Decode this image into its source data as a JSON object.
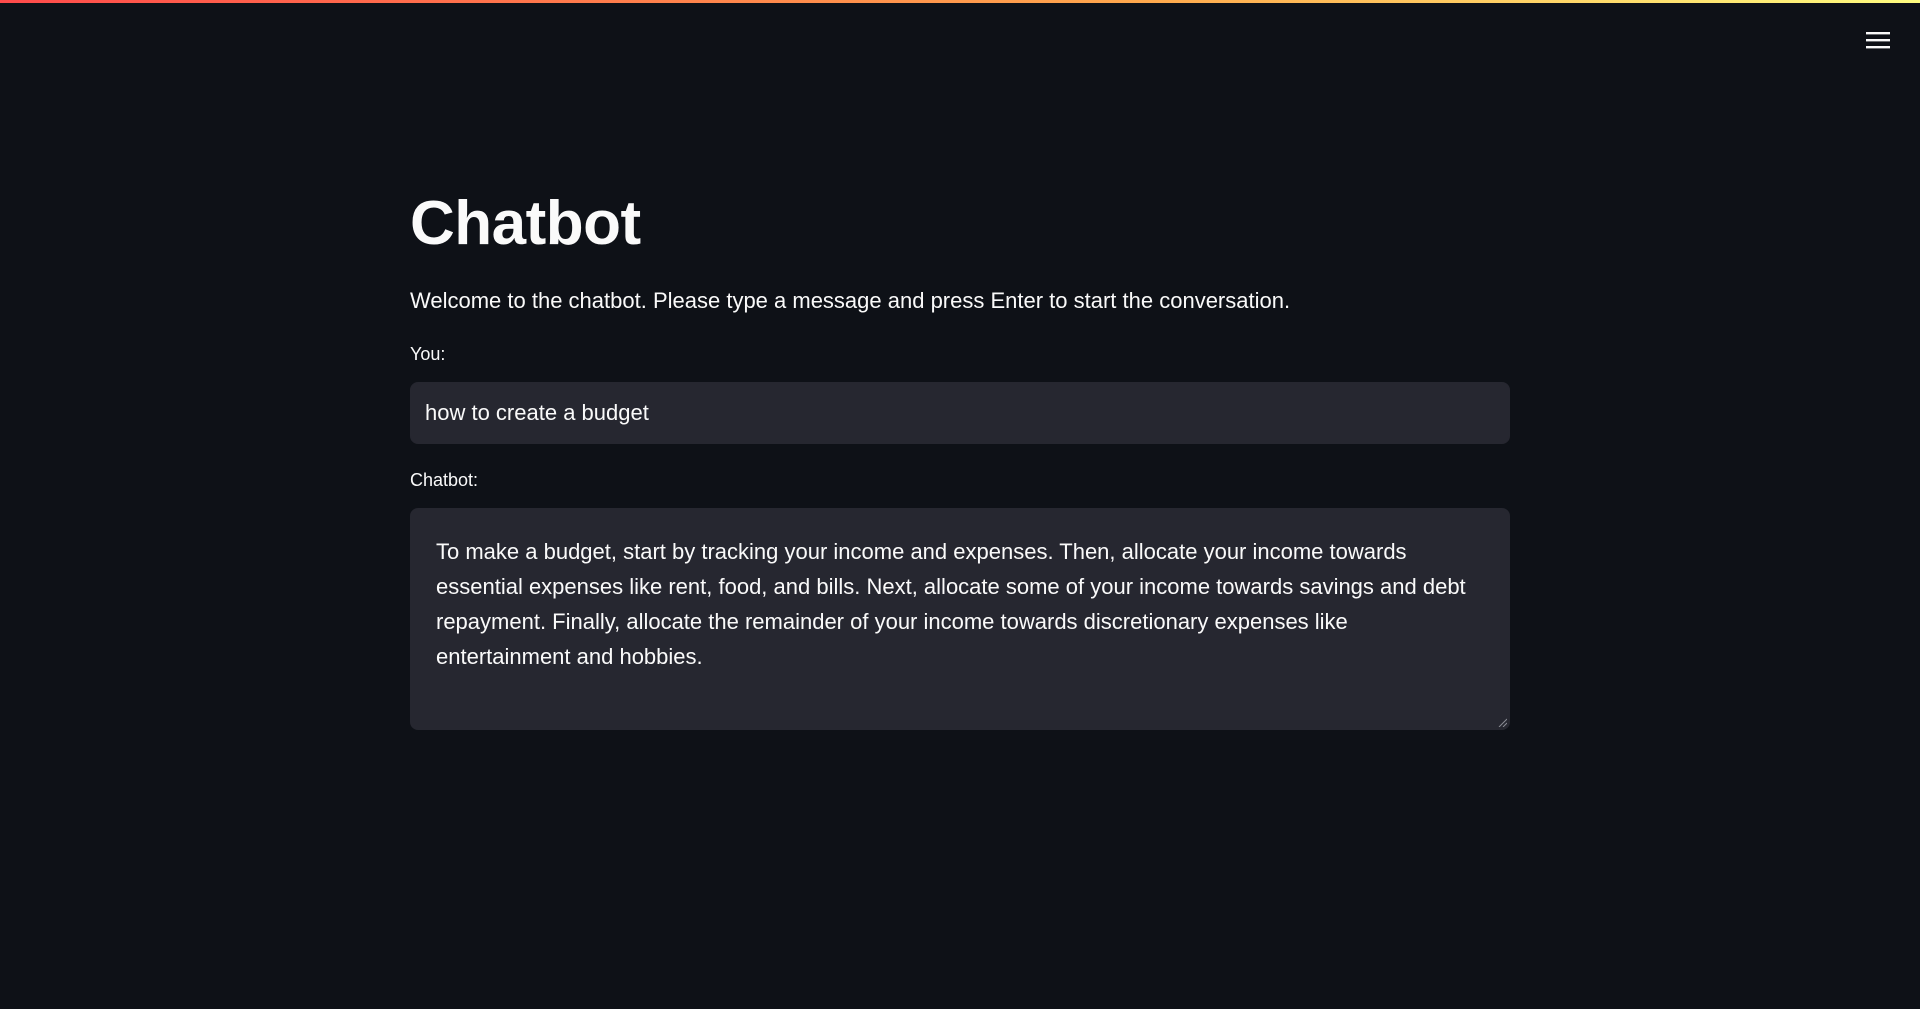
{
  "app": {
    "title": "Chatbot",
    "intro": "Welcome to the chatbot. Please type a message and press Enter to start the conversation."
  },
  "user_input": {
    "label": "You:",
    "value": "how to create a budget"
  },
  "bot_output": {
    "label": "Chatbot:",
    "value": "To make a budget, start by tracking your income and expenses. Then, allocate your income towards essential expenses like rent, food, and bills. Next, allocate some of your income towards savings and debt repayment. Finally, allocate the remainder of your income towards discretionary expenses like entertainment and hobbies."
  },
  "header": {
    "menu_icon": "hamburger-menu-icon"
  },
  "colors": {
    "background": "#0e1117",
    "input_background": "#262730",
    "text": "#fafafa",
    "accent_start": "#ff4b4b",
    "accent_end": "#fffd80"
  }
}
